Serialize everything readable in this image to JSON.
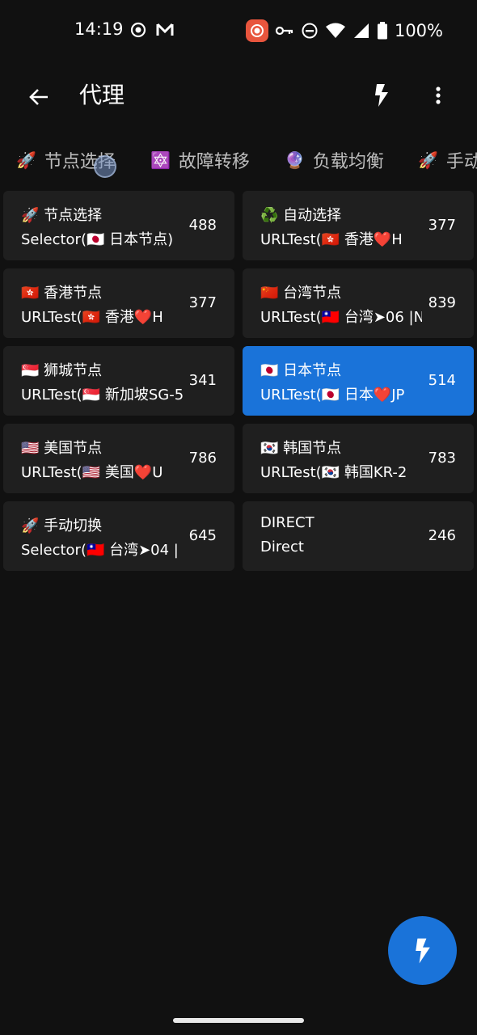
{
  "status": {
    "time": "14:19",
    "battery": "100%"
  },
  "appbar": {
    "title": "代理"
  },
  "tabs": [
    {
      "emoji": "🚀",
      "label": "节点选择"
    },
    {
      "emoji": "🔯",
      "label": "故障转移"
    },
    {
      "emoji": "🔮",
      "label": "负载均衡"
    },
    {
      "emoji": "🚀",
      "label": "手动"
    }
  ],
  "groups": [
    {
      "name": "🚀 节点选择",
      "sub": "Selector(🇯🇵 日本节点)",
      "count": "488",
      "selected": false
    },
    {
      "name": "♻️ 自动选择",
      "sub": "URLTest(🇭🇰 香港❤️H",
      "count": "377",
      "selected": false
    },
    {
      "name": "🇭🇰 香港节点",
      "sub": "URLTest(🇭🇰 香港❤️H",
      "count": "377",
      "selected": false
    },
    {
      "name": "🇨🇳 台湾节点",
      "sub": "URLTest(🇹🇼 台湾➤06 |N",
      "count": "839",
      "selected": false
    },
    {
      "name": "🇸🇬 狮城节点",
      "sub": "URLTest(🇸🇬 新加坡SG-5",
      "count": "341",
      "selected": false
    },
    {
      "name": "🇯🇵 日本节点",
      "sub": "URLTest(🇯🇵 日本❤️JP",
      "count": "514",
      "selected": true
    },
    {
      "name": "🇺🇸 美国节点",
      "sub": "URLTest(🇺🇸 美国❤️U",
      "count": "786",
      "selected": false
    },
    {
      "name": "🇰🇷 韩国节点",
      "sub": "URLTest(🇰🇷 韩国KR-2",
      "count": "783",
      "selected": false
    },
    {
      "name": "🚀 手动切换",
      "sub": "Selector(🇹🇼 台湾➤04 |",
      "count": "645",
      "selected": false
    },
    {
      "name": "DIRECT",
      "sub": "Direct",
      "count": "246",
      "selected": false
    }
  ],
  "colors": {
    "background": "#111111",
    "card": "#1f1f1f",
    "accent": "#1a73d9"
  },
  "icons": {
    "back": "arrow-back-icon",
    "test": "bolt-icon",
    "more": "more-vert-icon",
    "fab": "bolt-icon"
  }
}
